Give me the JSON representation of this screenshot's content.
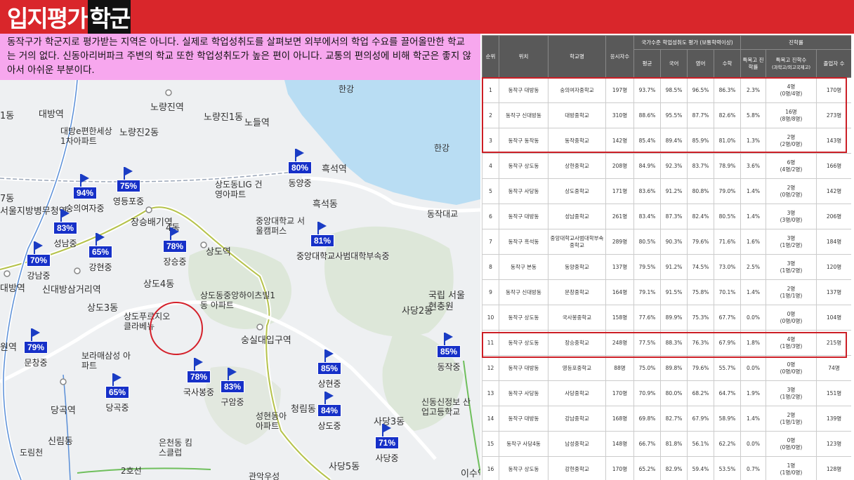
{
  "header": {
    "title_part1": "입지평가",
    "title_part2": "학군"
  },
  "description": "동작구가 학군지로 평가받는 지역은 아니다. 실제로 학업성취도를 살펴보면 외부에서의 학업 수요를 끌어올만한 학교는 거의 없다. 신동아리버파크 주변의 학교 또한 학업성취도가 높은 편이 아니다. 교통의 편의성에 비해 학군은 좋지 않아서 아쉬운 부분이다.",
  "map": {
    "place_labels": [
      "노량진역",
      "대방역",
      "1동",
      "노량진2동",
      "노량진1동",
      "노들역",
      "대방e편한세상 1차아파트",
      "한강",
      "흑석역",
      "흑석동",
      "상도동LIG 건영아파트",
      "중앙대학교 서울캠퍼스",
      "장승배기역",
      "상도역",
      "신대방삼거리역",
      "대방역",
      "서울지방병무청역",
      "7동",
      "상도4동",
      "상도3동",
      "상도푸르지오 클라베뉴",
      "상도동중앙하이츠빌1동 아파트",
      "숭실대입구역",
      "국립 서울현충원",
      "사당2동",
      "보라매삼성 아파트",
      "원역",
      "당곡역",
      "신림동",
      "도림천",
      "2호선",
      "청림동",
      "성현동아 아파트",
      "은천동 킴스클럽",
      "사당5동",
      "사당3동",
      "신동신정보 산업고등학교",
      "이수역",
      "관악우성",
      "동작대교",
      "한강",
      "4동"
    ],
    "markers": [
      {
        "pct": "94%",
        "name": "숭의여자중"
      },
      {
        "pct": "75%",
        "name": "영등포중"
      },
      {
        "pct": "83%",
        "name": "성남중"
      },
      {
        "pct": "65%",
        "name": "강현중"
      },
      {
        "pct": "70%",
        "name": "강남중"
      },
      {
        "pct": "78%",
        "name": "장승중"
      },
      {
        "pct": "80%",
        "name": "동양중"
      },
      {
        "pct": "81%",
        "name": "중앙대학교사범대학부속중"
      },
      {
        "pct": "79%",
        "name": "문창중"
      },
      {
        "pct": "65%",
        "name": "당곡중"
      },
      {
        "pct": "78%",
        "name": "국사봉중"
      },
      {
        "pct": "83%",
        "name": "구암중"
      },
      {
        "pct": "85%",
        "name": "상현중"
      },
      {
        "pct": "84%",
        "name": "상도중"
      },
      {
        "pct": "85%",
        "name": "동작중"
      },
      {
        "pct": "71%",
        "name": "사당중"
      }
    ]
  },
  "table": {
    "headers": {
      "rank": "순위",
      "location": "위치",
      "school": "학교명",
      "examinees": "응시자수",
      "group1": "국가수준 학업성취도 평가 (보통학력이상)",
      "avg": "평균",
      "kor": "국어",
      "eng": "영어",
      "math": "수학",
      "group2": "진학률",
      "special_rate": "특목고 진학률",
      "special_count": "특목고 진학수",
      "special_sub": "(과학고/외고국제고)",
      "graduates": "졸업자 수"
    },
    "rows": [
      {
        "rank": "1",
        "loc": "동작구 대방동",
        "school": "숭의여자중학교",
        "exam": "197명",
        "avg": "93.7%",
        "kor": "98.5%",
        "eng": "96.5%",
        "math": "86.3%",
        "rate": "2.3%",
        "count": "4명",
        "count_sub": "(0명/4명)",
        "grad": "170명"
      },
      {
        "rank": "2",
        "loc": "동작구 신대방동",
        "school": "대방중학교",
        "exam": "310명",
        "avg": "88.6%",
        "kor": "95.5%",
        "eng": "87.7%",
        "math": "82.6%",
        "rate": "5.8%",
        "count": "16명",
        "count_sub": "(8명/8명)",
        "grad": "273명"
      },
      {
        "rank": "3",
        "loc": "동작구 동작동",
        "school": "동작중학교",
        "exam": "142명",
        "avg": "85.4%",
        "kor": "89.4%",
        "eng": "85.9%",
        "math": "81.0%",
        "rate": "1.3%",
        "count": "2명",
        "count_sub": "(2명/0명)",
        "grad": "143명"
      },
      {
        "rank": "4",
        "loc": "동작구 상도동",
        "school": "상현중학교",
        "exam": "208명",
        "avg": "84.9%",
        "kor": "92.3%",
        "eng": "83.7%",
        "math": "78.9%",
        "rate": "3.6%",
        "count": "6명",
        "count_sub": "(4명/2명)",
        "grad": "166명"
      },
      {
        "rank": "5",
        "loc": "동작구 사당동",
        "school": "상도중학교",
        "exam": "171명",
        "avg": "83.6%",
        "kor": "91.2%",
        "eng": "80.8%",
        "math": "79.0%",
        "rate": "1.4%",
        "count": "2명",
        "count_sub": "(0명/2명)",
        "grad": "142명"
      },
      {
        "rank": "6",
        "loc": "동작구 대방동",
        "school": "성남중학교",
        "exam": "261명",
        "avg": "83.4%",
        "kor": "87.3%",
        "eng": "82.4%",
        "math": "80.5%",
        "rate": "1.4%",
        "count": "3명",
        "count_sub": "(3명/0명)",
        "grad": "206명"
      },
      {
        "rank": "7",
        "loc": "동작구 흑석동",
        "school": "중앙대학교사범대학부속중학교",
        "exam": "289명",
        "avg": "80.5%",
        "kor": "90.3%",
        "eng": "79.6%",
        "math": "71.6%",
        "rate": "1.6%",
        "count": "3명",
        "count_sub": "(1명/2명)",
        "grad": "184명"
      },
      {
        "rank": "8",
        "loc": "동작구 본동",
        "school": "동양중학교",
        "exam": "137명",
        "avg": "79.5%",
        "kor": "91.2%",
        "eng": "74.5%",
        "math": "73.0%",
        "rate": "2.5%",
        "count": "3명",
        "count_sub": "(1명/2명)",
        "grad": "120명"
      },
      {
        "rank": "9",
        "loc": "동작구 신대방동",
        "school": "문창중학교",
        "exam": "164명",
        "avg": "79.1%",
        "kor": "91.5%",
        "eng": "75.8%",
        "math": "70.1%",
        "rate": "1.4%",
        "count": "2명",
        "count_sub": "(1명/1명)",
        "grad": "137명"
      },
      {
        "rank": "10",
        "loc": "동작구 상도동",
        "school": "국사봉중학교",
        "exam": "158명",
        "avg": "77.6%",
        "kor": "89.9%",
        "eng": "75.3%",
        "math": "67.7%",
        "rate": "0.0%",
        "count": "0명",
        "count_sub": "(0명/0명)",
        "grad": "104명"
      },
      {
        "rank": "11",
        "loc": "동작구 상도동",
        "school": "장승중학교",
        "exam": "248명",
        "avg": "77.5%",
        "kor": "88.3%",
        "eng": "76.3%",
        "math": "67.9%",
        "rate": "1.8%",
        "count": "4명",
        "count_sub": "(1명/3명)",
        "grad": "215명"
      },
      {
        "rank": "12",
        "loc": "동작구 대방동",
        "school": "영등포중학교",
        "exam": "88명",
        "avg": "75.0%",
        "kor": "89.8%",
        "eng": "79.6%",
        "math": "55.7%",
        "rate": "0.0%",
        "count": "0명",
        "count_sub": "(0명/0명)",
        "grad": "74명"
      },
      {
        "rank": "13",
        "loc": "동작구 사당동",
        "school": "사당중학교",
        "exam": "170명",
        "avg": "70.9%",
        "kor": "80.0%",
        "eng": "68.2%",
        "math": "64.7%",
        "rate": "1.9%",
        "count": "3명",
        "count_sub": "(1명/2명)",
        "grad": "151명"
      },
      {
        "rank": "14",
        "loc": "동작구 대방동",
        "school": "강남중학교",
        "exam": "168명",
        "avg": "69.8%",
        "kor": "82.7%",
        "eng": "67.9%",
        "math": "58.9%",
        "rate": "1.4%",
        "count": "2명",
        "count_sub": "(1명/1명)",
        "grad": "139명"
      },
      {
        "rank": "15",
        "loc": "동작구 사당4동",
        "school": "남성중학교",
        "exam": "148명",
        "avg": "66.7%",
        "kor": "81.8%",
        "eng": "56.1%",
        "math": "62.2%",
        "rate": "0.0%",
        "count": "0명",
        "count_sub": "(0명/0명)",
        "grad": "123명"
      },
      {
        "rank": "16",
        "loc": "동작구 상도동",
        "school": "강현중학교",
        "exam": "170명",
        "avg": "65.2%",
        "kor": "82.9%",
        "eng": "59.4%",
        "math": "53.5%",
        "rate": "0.7%",
        "count": "1명",
        "count_sub": "(1명/0명)",
        "grad": "128명"
      }
    ]
  },
  "colors": {
    "title_bar": "#d9262b",
    "desc_bg": "#f7a7ee",
    "marker": "#1630c8",
    "highlight": "#cc1f26",
    "table_header": "#595959"
  }
}
